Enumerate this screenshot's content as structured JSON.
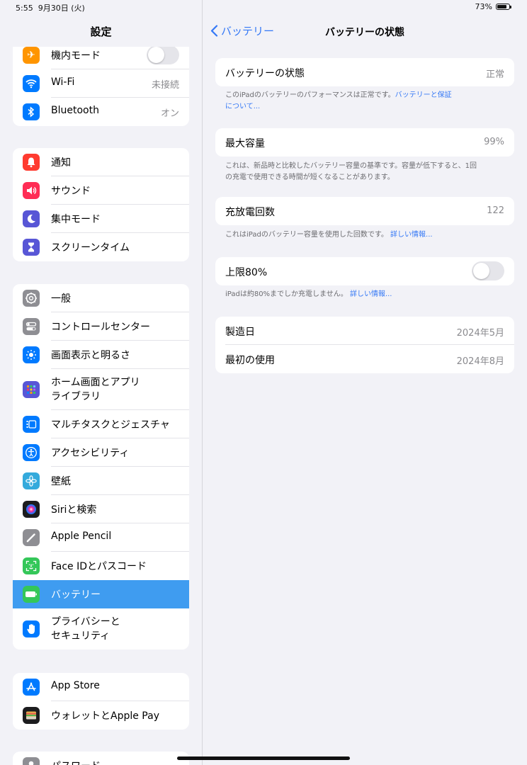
{
  "status_bar": {
    "time": "5:55",
    "date": "9月30日 (火)",
    "battery_percent": "73%",
    "battery_level": 0.73
  },
  "sidebar": {
    "title": "設定",
    "groups": [
      {
        "items": [
          {
            "label": "機内モード",
            "icon": "airplane-icon",
            "color": "#ff9500",
            "toggle": false
          },
          {
            "label": "Wi-Fi",
            "icon": "wifi-icon",
            "color": "#007aff",
            "value": "未接続"
          },
          {
            "label": "Bluetooth",
            "icon": "bluetooth-icon",
            "color": "#007aff",
            "value": "オン"
          }
        ]
      },
      {
        "items": [
          {
            "label": "通知",
            "icon": "bell-icon",
            "color": "#ff3b30"
          },
          {
            "label": "サウンド",
            "icon": "speaker-icon",
            "color": "#ff2d55"
          },
          {
            "label": "集中モード",
            "icon": "moon-icon",
            "color": "#5856d6"
          },
          {
            "label": "スクリーンタイム",
            "icon": "hourglass-icon",
            "color": "#5856d6"
          }
        ]
      },
      {
        "items": [
          {
            "label": "一般",
            "icon": "gear-icon",
            "color": "#8e8e93"
          },
          {
            "label": "コントロールセンター",
            "icon": "switches-icon",
            "color": "#8e8e93"
          },
          {
            "label": "画面表示と明るさ",
            "icon": "sun-icon",
            "color": "#007aff"
          },
          {
            "label": "ホーム画面とアプリ",
            "label2": "ライブラリ",
            "icon": "app-grid-icon",
            "color": "#5856d6"
          },
          {
            "label": "マルチタスクとジェスチャ",
            "icon": "multitask-icon",
            "color": "#007aff"
          },
          {
            "label": "アクセシビリティ",
            "icon": "accessibility-icon",
            "color": "#007aff"
          },
          {
            "label": "壁紙",
            "icon": "flower-icon",
            "color": "#34aadc"
          },
          {
            "label": "Siriと検索",
            "icon": "siri-icon",
            "color": "#1c1c1e"
          },
          {
            "label": "Apple Pencil",
            "icon": "pencil-icon",
            "color": "#8e8e93"
          },
          {
            "label": "Face IDとパスコード",
            "icon": "faceid-icon",
            "color": "#34c759"
          },
          {
            "label": "バッテリー",
            "icon": "battery-icon",
            "color": "#34c759",
            "selected": true
          },
          {
            "label": "プライバシーと",
            "label2": "セキュリティ",
            "icon": "hand-icon",
            "color": "#007aff"
          }
        ]
      },
      {
        "items": [
          {
            "label": "App Store",
            "icon": "appstore-icon",
            "color": "#007aff"
          },
          {
            "label": "ウォレットとApple Pay",
            "icon": "wallet-icon",
            "color": "#1c1c1e"
          }
        ]
      },
      {
        "items": [
          {
            "label": "パスワード",
            "icon": "key-icon",
            "color": "#8e8e93"
          }
        ]
      }
    ]
  },
  "detail": {
    "back_label": "バッテリー",
    "title": "バッテリーの状態",
    "health": {
      "label": "バッテリーの状態",
      "value": "正常"
    },
    "health_note": "このiPadのバッテリーのパフォーマンスは正常です。",
    "health_link_1": "バッテリーと保証",
    "health_link_2": "について...",
    "capacity": {
      "label": "最大容量",
      "value": "99%"
    },
    "capacity_note_1": "これは、新品時と比較したバッテリー容量の基準です。容量が低下すると、1回",
    "capacity_note_2": "の充電で使用できる時間が短くなることがあります。",
    "cycles": {
      "label": "充放電回数",
      "value": "122"
    },
    "cycles_note": "これはiPadのバッテリー容量を使用した回数です。",
    "cycles_link": "詳しい情報...",
    "limit": {
      "label": "上限80%",
      "toggle": false
    },
    "limit_note": "iPadは約80%までしか充電しません。",
    "limit_link": "詳しい情報...",
    "manufactured": {
      "label": "製造日",
      "value": "2024年5月"
    },
    "first_use": {
      "label": "最初の使用",
      "value": "2024年8月"
    }
  }
}
